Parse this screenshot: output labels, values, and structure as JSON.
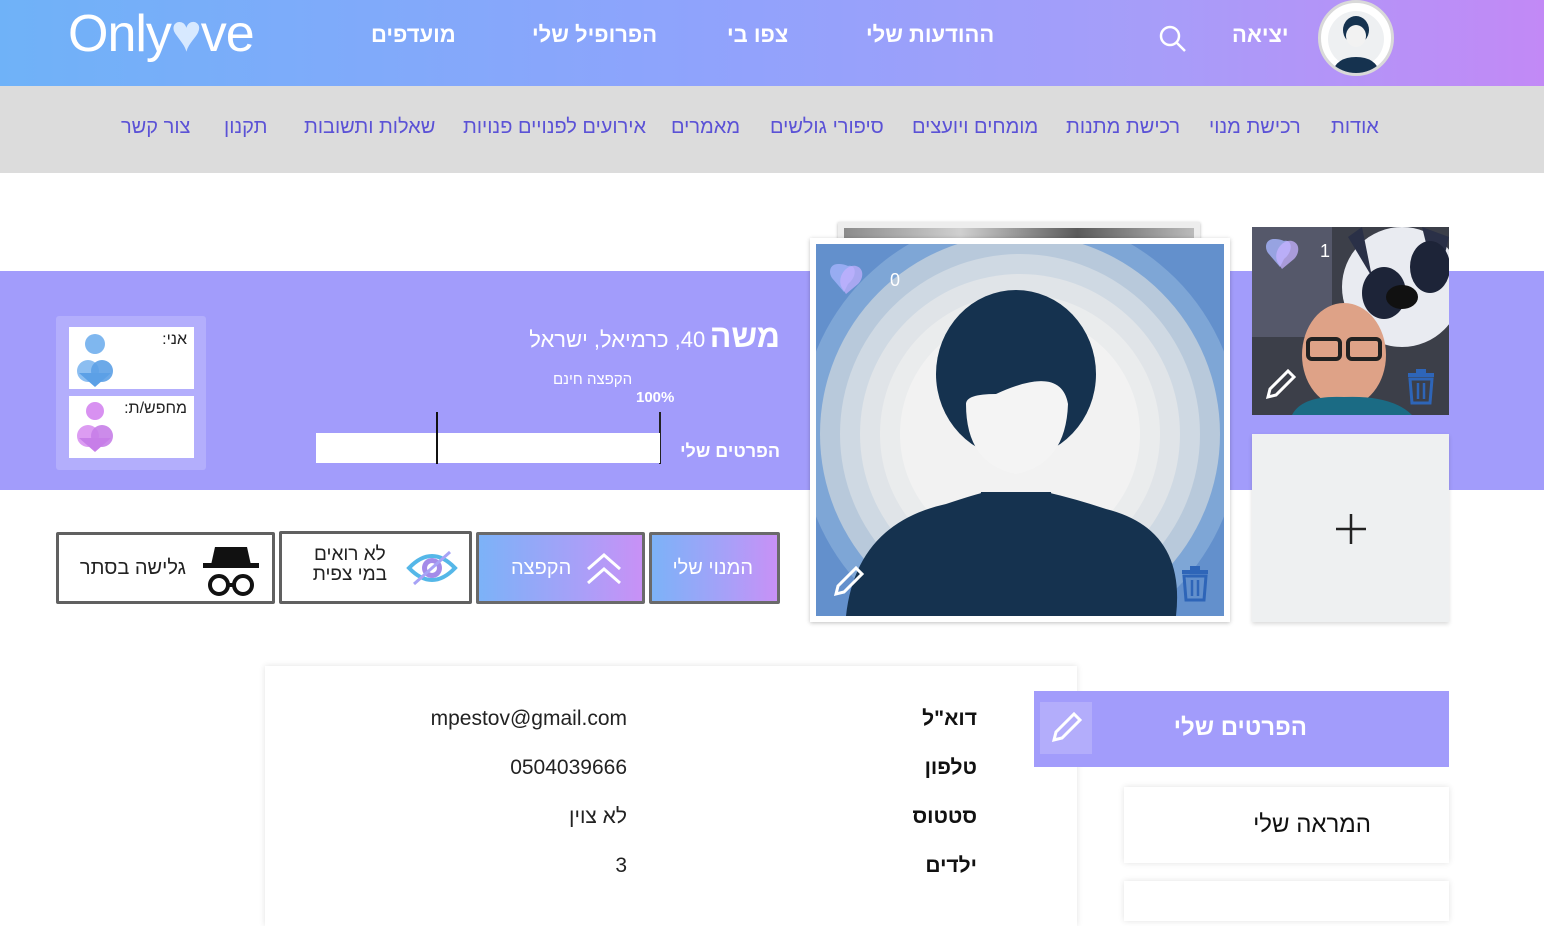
{
  "header": {
    "logo_text_1": "Only",
    "logo_text_2": "ve",
    "nav": [
      "מועדפים",
      "הפרופיל שלי",
      "צפו בי",
      "ההודעות שלי"
    ],
    "logout": "יציאה"
  },
  "subnav": [
    "אודות",
    "רכישת מנוי",
    "רכישת מתנות",
    "מומחים ויועצים",
    "סיפורי גולשים",
    "מאמרים",
    "אירועים לפנויים פנויות",
    "שאלות ותשובות",
    "תקנון",
    "צור קשר"
  ],
  "profile": {
    "name": "משה",
    "details": "40, כרמיאל, ישראל",
    "boost_label": "הקפצה חינם",
    "boost_percent": "100%",
    "progress_label": "הפרטים שלי",
    "progress_fill": 0.65,
    "me_label": "אני:",
    "seeking_label": "מחפש/ת:",
    "main_photo_likes": "0",
    "thumb_photo_likes": "1"
  },
  "actions": {
    "subscription": "המנוי שלי",
    "boost": "הקפצה",
    "invisible_line1": "לא רואים",
    "invisible_line2": "במי צפית",
    "incognito": "גלישה בסתר"
  },
  "sidebar": {
    "details_title": "הפרטים שלי",
    "appearance": "המראה שלי"
  },
  "details": [
    {
      "label": "דוא\"ל",
      "value": "mpestov@gmail.com"
    },
    {
      "label": "טלפון",
      "value": "0504039666"
    },
    {
      "label": "סטטוס",
      "value": "לא צוין"
    },
    {
      "label": "ילדים",
      "value": "3"
    }
  ],
  "colors": {
    "band": "#a29cfb",
    "nav_link": "#5b52d6",
    "dark_avatar": "#15324f"
  }
}
